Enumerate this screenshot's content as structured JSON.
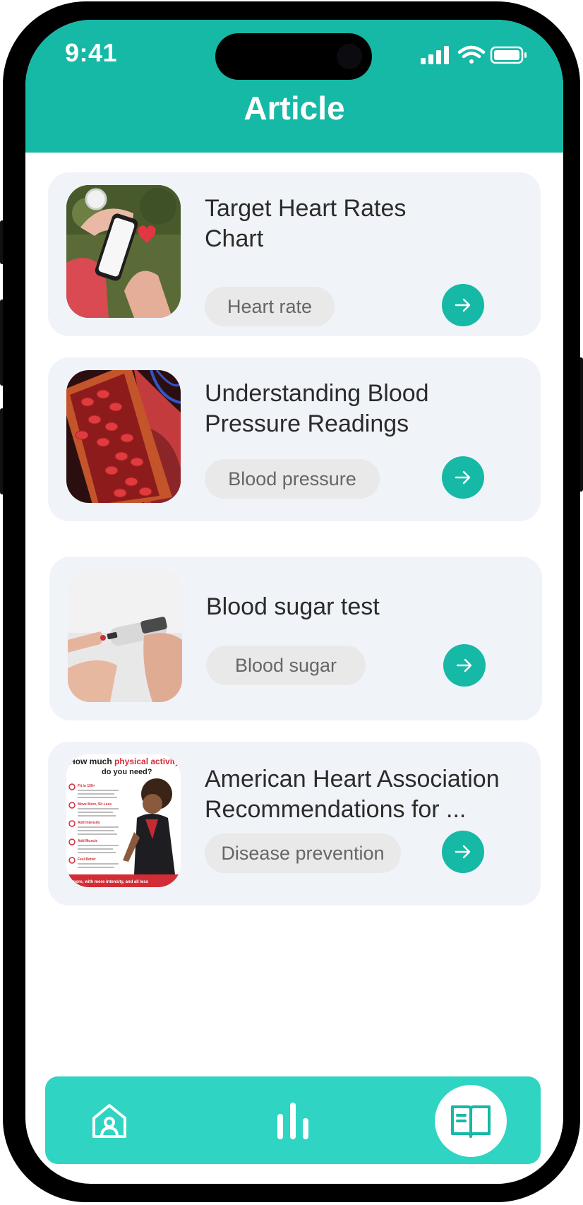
{
  "status_bar": {
    "time": "9:41",
    "icons": [
      "signal-icon",
      "wifi-icon",
      "battery-icon"
    ]
  },
  "header": {
    "title": "Article",
    "color": "#16b8a6"
  },
  "articles": [
    {
      "title": "Target Heart Rates Chart",
      "tag": "Heart rate",
      "image": "smartwatch-heart-rate-photo"
    },
    {
      "title": "Understanding Blood Pressure Readings",
      "tag": "Blood pressure",
      "image": "blood-vessel-illustration"
    },
    {
      "title": "Blood sugar test",
      "tag": "Blood sugar",
      "image": "glucose-lancet-photo"
    },
    {
      "title": "American Heart Association Recommendations for ...",
      "tag": "Disease prevention",
      "image": "physical-activity-infographic",
      "image_text": {
        "headline_prefix": "How much",
        "headline_highlight": "physical activity",
        "headline_suffix": "do you need?",
        "sections": [
          "Fit in 150+",
          "Move More, Sit Less",
          "Add Intensity",
          "Add Muscle",
          "Feel Better"
        ],
        "footer": "more, with more intensity, and all less"
      }
    }
  ],
  "bottom_nav": {
    "items": [
      {
        "icon": "home-icon",
        "active": false
      },
      {
        "icon": "stats-icon",
        "active": false
      },
      {
        "icon": "article-book-icon",
        "active": true
      }
    ],
    "color": "#2fd4c2"
  }
}
